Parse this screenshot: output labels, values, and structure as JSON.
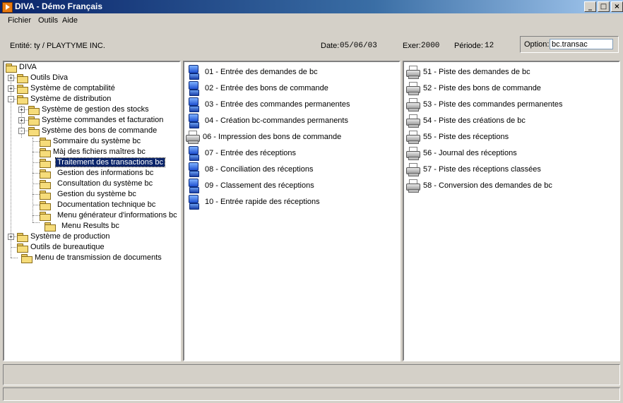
{
  "window": {
    "title": "DIVA - Démo Français",
    "buttons": [
      "_",
      "□",
      "×"
    ]
  },
  "menu": [
    "Fichier",
    "Outils",
    "Aide"
  ],
  "info": {
    "entity": "Entité:  ty / PLAYTYME INC.",
    "date_label": "Date:",
    "date": "05/06/03",
    "exer_label": "Exer:",
    "exer": "2000",
    "period_label": "Période:",
    "period": "12",
    "option_label": "Option:",
    "option_value": "bc.transac"
  },
  "tree": [
    {
      "label": "DIVA",
      "level": 0,
      "expander": ""
    },
    {
      "label": "Outils Diva",
      "level": 1,
      "expander": "+"
    },
    {
      "label": "Système de comptabilité",
      "level": 1,
      "expander": "+"
    },
    {
      "label": "Système de distribution",
      "level": 1,
      "expander": "-"
    },
    {
      "label": "Système de gestion des stocks",
      "level": 2,
      "expander": "+"
    },
    {
      "label": "Système commandes et facturation",
      "level": 2,
      "expander": "+"
    },
    {
      "label": "Système des bons de commande",
      "level": 2,
      "expander": "-"
    },
    {
      "label": "Sommaire du système bc",
      "level": 3,
      "expander": ""
    },
    {
      "label": "Màj des fichiers maîtres bc",
      "level": 3,
      "expander": ""
    },
    {
      "label": "Traitement des transactions bc",
      "level": 3,
      "expander": "",
      "selected": true
    },
    {
      "label": "Gestion des informations bc",
      "level": 3,
      "expander": ""
    },
    {
      "label": "Consultation du système bc",
      "level": 3,
      "expander": ""
    },
    {
      "label": "Gestion du système bc",
      "level": 3,
      "expander": ""
    },
    {
      "label": "Documentation technique bc",
      "level": 3,
      "expander": ""
    },
    {
      "label": "Menu générateur d'informations bc",
      "level": 3,
      "expander": ""
    },
    {
      "label": "Menu Results bc",
      "level": 3,
      "expander": ""
    },
    {
      "label": "Système de production",
      "level": 1,
      "expander": "+"
    },
    {
      "label": "Outils de bureautique",
      "level": 1,
      "expander": ""
    },
    {
      "label": "Menu de transmission de documents",
      "level": 1,
      "expander": ""
    }
  ],
  "middle_list": [
    {
      "label": "01 - Entrée des demandes de bc",
      "icon": "computer-icon"
    },
    {
      "label": "02 - Entrée des bons de commande",
      "icon": "computer-icon"
    },
    {
      "label": "03 - Entrée des commandes permanentes",
      "icon": "computer-icon"
    },
    {
      "label": "04 - Création bc-commandes permanents",
      "icon": "computer-icon"
    },
    {
      "label": "06 - Impression des bons de commande",
      "icon": "printer-icon"
    },
    {
      "label": "07 - Entrée des réceptions",
      "icon": "computer-icon"
    },
    {
      "label": "08 - Conciliation des réceptions",
      "icon": "computer-icon"
    },
    {
      "label": "09 - Classement des réceptions",
      "icon": "computer-icon"
    },
    {
      "label": "10 - Entrée rapide des réceptions",
      "icon": "computer-icon"
    }
  ],
  "right_list": [
    {
      "label": "51 - Piste des demandes de bc",
      "icon": "printer-icon"
    },
    {
      "label": "52 - Piste des bons de commande",
      "icon": "printer-icon"
    },
    {
      "label": "53 - Piste des commandes permanentes",
      "icon": "printer-icon"
    },
    {
      "label": "54 - Piste des créations de bc",
      "icon": "printer-icon"
    },
    {
      "label": "55 - Piste des réceptions",
      "icon": "printer-icon"
    },
    {
      "label": "56 - Journal des réceptions",
      "icon": "printer-icon"
    },
    {
      "label": "57 - Piste des réceptions classées",
      "icon": "printer-icon"
    },
    {
      "label": "58 - Conversion des demandes de bc",
      "icon": "printer-icon"
    }
  ],
  "colors": {
    "title_gradient_start": "#0a246a",
    "title_gradient_end": "#a6caf0",
    "selection": "#0a246a",
    "window_bg": "#d4d0c8"
  }
}
